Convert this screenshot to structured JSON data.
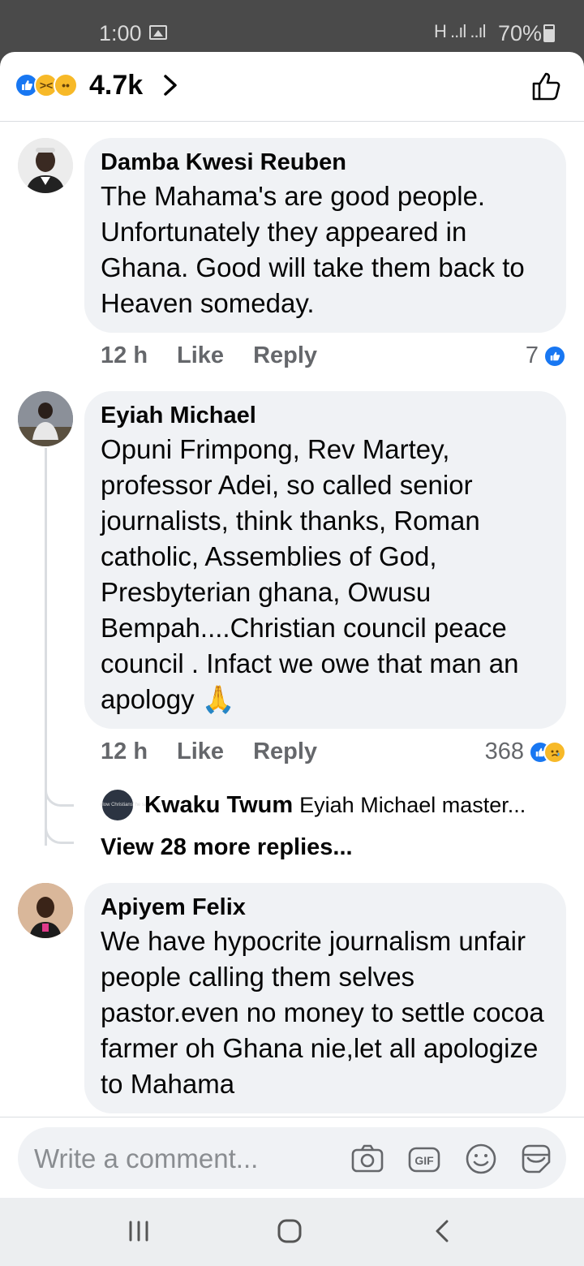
{
  "status_bar": {
    "time": "1:00",
    "signal": "H ..ıl ..ıl",
    "battery": "70%"
  },
  "header": {
    "reaction_count": "4.7k",
    "reactions": [
      "like",
      "haha",
      "sad"
    ]
  },
  "comments": [
    {
      "author": "Damba Kwesi Reuben",
      "text": "The Mahama's are good people. Unfortunately they appeared in Ghana. Good will take them back to Heaven someday.",
      "time": "12 h",
      "like_label": "Like",
      "reply_label": "Reply",
      "reaction_count": "7",
      "reactions": [
        "like"
      ]
    },
    {
      "author": "Eyiah Michael",
      "text": "Opuni Frimpong, Rev Martey, professor Adei, so called senior journalists, think thanks, Roman catholic, Assemblies of God, Presbyterian ghana, Owusu Bempah....Christian council peace council . Infact we owe that man an apology 🙏",
      "time": "12 h",
      "like_label": "Like",
      "reply_label": "Reply",
      "reaction_count": "368",
      "reactions": [
        "like",
        "sad"
      ],
      "reply_preview": {
        "author": "Kwaku Twum",
        "text": "Eyiah Michael master...",
        "avatar_text": "Some didn't say 'follow Christians' he said 'follow me'"
      },
      "more_replies": "View 28 more replies..."
    },
    {
      "author": "Apiyem Felix",
      "text": "We have hypocrite journalism unfair people calling them selves pastor.even no money to settle cocoa farmer oh Ghana nie,let all apologize to Mahama"
    }
  ],
  "composer": {
    "placeholder": "Write a comment...",
    "icons": [
      "camera-icon",
      "gif-icon",
      "emoji-icon",
      "sticker-icon"
    ]
  },
  "nav": {
    "icons": [
      "recent-apps-icon",
      "home-icon",
      "back-icon"
    ]
  },
  "colors": {
    "accent": "#1877f2",
    "bubble": "#f0f2f5",
    "muted": "#65676b"
  }
}
